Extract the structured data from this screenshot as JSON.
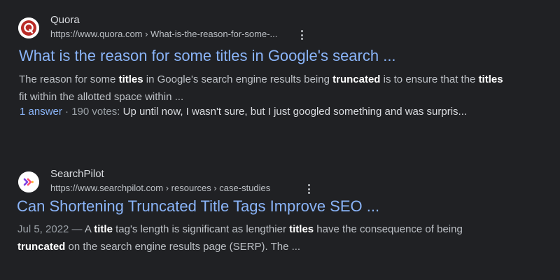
{
  "results": [
    {
      "site_name": "Quora",
      "url": "https://www.quora.com › What-is-the-reason-for-some-...",
      "title": "What is the reason for some titles in Google's search ...",
      "snippet": [
        {
          "text": "The reason for some ",
          "bold": false
        },
        {
          "text": "titles",
          "bold": true
        },
        {
          "text": " in Google's search engine results being ",
          "bold": false
        },
        {
          "text": "truncated",
          "bold": true
        },
        {
          "text": " is to ensure that the ",
          "bold": false
        },
        {
          "text": "titles",
          "bold": true
        },
        {
          "text": " fit within the allotted space within ...",
          "bold": false
        }
      ],
      "answers_label": "1 answer",
      "separator": " · ",
      "votes_label": "190 votes: ",
      "answer_snippet": "Up until now, I wasn't sure, but I just googled something and was surpris...",
      "favicon": "quora-icon",
      "favicon_color": "#b92b27"
    },
    {
      "site_name": "SearchPilot",
      "url": "https://www.searchpilot.com › resources › case-studies",
      "title": "Can Shortening Truncated Title Tags Improve SEO ...",
      "date": "Jul 5, 2022 — ",
      "snippet": [
        {
          "text": "A ",
          "bold": false
        },
        {
          "text": "title",
          "bold": true
        },
        {
          "text": " tag's length is significant as lengthier ",
          "bold": false
        },
        {
          "text": "titles",
          "bold": true
        },
        {
          "text": " have the consequence of being ",
          "bold": false
        },
        {
          "text": "truncated",
          "bold": true
        },
        {
          "text": " on the search engine results page (SERP). The ...",
          "bold": false
        }
      ],
      "favicon": "searchpilot-icon",
      "favicon_colors": [
        "#7b3fe4",
        "#ff4d6d",
        "#ffb020"
      ]
    }
  ],
  "colors": {
    "background": "#202124",
    "link": "#8ab4f8",
    "text": "#bdc1c6",
    "bold_text": "#ffffff",
    "meta": "#9aa0a6"
  }
}
